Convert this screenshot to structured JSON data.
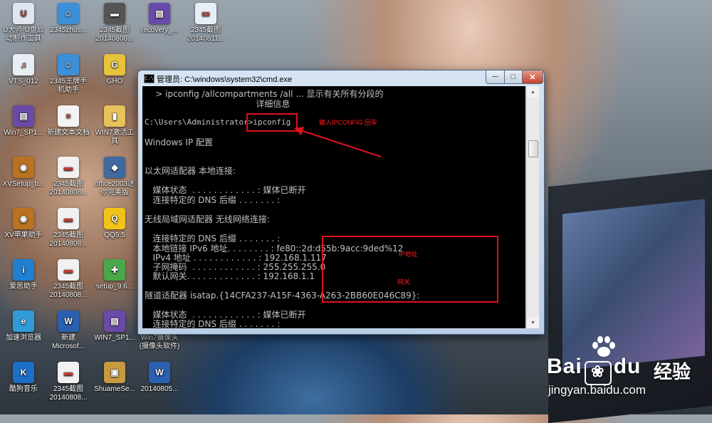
{
  "desktop": {
    "icons": [
      {
        "label": "U大师·U盘启\n动制作工具",
        "icon": "usb-tool-icon",
        "color": "#dfe6ef",
        "glyph": "U"
      },
      {
        "label": "2345zhus...",
        "icon": "helper-icon",
        "color": "#3d8fd8",
        "glyph": "☺"
      },
      {
        "label": "2345截图\n20140808...",
        "icon": "screenshot-icon",
        "color": "#555555",
        "glyph": "▬"
      },
      {
        "label": "recovery_...",
        "icon": "winrar-icon",
        "color": "#6a4aa8",
        "glyph": "▤"
      },
      {
        "label": "2345截图\n20140811...",
        "icon": "screenshot-icon",
        "color": "#e8eef5",
        "glyph": "▭"
      },
      {
        "label": "VTS_012",
        "icon": "mp3-icon",
        "color": "#e8eef5",
        "glyph": "♫"
      },
      {
        "label": "2345王牌手\n机助手",
        "icon": "phone-helper-icon",
        "color": "#3d8fd8",
        "glyph": "☺"
      },
      {
        "label": "GHO",
        "icon": "gho-icon",
        "color": "#e6c33a",
        "glyph": "G"
      },
      {
        "label": "Win7_SP1...",
        "icon": "winrar-icon",
        "color": "#6a4aa8",
        "glyph": "▤"
      },
      {
        "label": "新建文本文档",
        "icon": "text-file-icon",
        "color": "#f3f3f3",
        "glyph": "≡"
      },
      {
        "label": "WIN7激活工\n具",
        "icon": "folder-icon",
        "color": "#e8c25a",
        "glyph": "▮"
      },
      {
        "label": "XVSetup_b...",
        "icon": "owl-icon",
        "color": "#b9721f",
        "glyph": "◉"
      },
      {
        "label": "2345截图\n20140808...",
        "icon": "screenshot-icon",
        "color": "#f1f1f1",
        "glyph": "▬"
      },
      {
        "label": "office2003迷\n你完美版",
        "icon": "office-icon",
        "color": "#3f6aa0",
        "glyph": "◆"
      },
      {
        "label": "XV苹果助手",
        "icon": "owl-icon",
        "color": "#b9721f",
        "glyph": "◉"
      },
      {
        "label": "2345截图\n20140808...",
        "icon": "screenshot-icon",
        "color": "#f1f1f1",
        "glyph": "▬"
      },
      {
        "label": "QQ5.5",
        "icon": "qq-icon",
        "color": "#f0c419",
        "glyph": "Q"
      },
      {
        "label": "爱思助手",
        "icon": "aisi-icon",
        "color": "#1f7fd1",
        "glyph": "i"
      },
      {
        "label": "2345截图\n20140808...",
        "icon": "screenshot-icon",
        "color": "#f1f1f1",
        "glyph": "▬"
      },
      {
        "label": "setup_9.6...",
        "icon": "game-icon",
        "color": "#4aa84a",
        "glyph": "✚"
      },
      {
        "label": "加速浏览器",
        "icon": "browser-icon",
        "color": "#2f9bd8",
        "glyph": "e"
      },
      {
        "label": "新建\nMicrosof...",
        "icon": "word-doc-icon",
        "color": "#2b5fb0",
        "glyph": "W"
      },
      {
        "label": "WIN7_SP1...",
        "icon": "winrar-icon",
        "color": "#6a4aa8",
        "glyph": "▤"
      },
      {
        "label": "Win7摄像头\n(摄像头软件)",
        "icon": "camera-icon",
        "color": "#5a5a5a",
        "glyph": "◎"
      },
      {
        "label": "酷狗音乐",
        "icon": "kugou-icon",
        "color": "#1b6fc8",
        "glyph": "K"
      },
      {
        "label": "2345截图\n20140808...",
        "icon": "screenshot-icon",
        "color": "#f1f1f1",
        "glyph": "▬"
      },
      {
        "label": "ShuameSe...",
        "icon": "package-icon",
        "color": "#c89a3e",
        "glyph": "▣"
      },
      {
        "label": "20140805...",
        "icon": "word-doc-icon",
        "color": "#2b5fb0",
        "glyph": "W"
      }
    ]
  },
  "window": {
    "title": "管理员: C:\\windows\\system32\\cmd.exe",
    "title_icon": "C:\\",
    "controls": {
      "minimize": "─",
      "maximize": "□",
      "close": "✕"
    }
  },
  "console": {
    "lines": [
      "    > ipconfig /allcompartments /all ... 显示有关所有分段的",
      "                                         详细信息",
      "C:\\Users\\Administrator>ipconfig",
      "Windows IP 配置",
      "以太网适配器 本地连接:",
      "   媒体状态  . . . . . . . . . . . . : 媒体已断开",
      "   连接特定的 DNS 后缀 . . . . . . . :",
      "无线局域网适配器 无线网络连接:",
      "   连接特定的 DNS 后缀 . . . . . . . :",
      "   本地链接 IPv6 地址. . . . . . . . : fe80::2d:d55b:9acc:9ded%12",
      "   IPv4 地址 . . . . . . . . . . . . : 192.168.1.117",
      "   子网掩码  . . . . . . . . . . . . : 255.255.255.0",
      "   默认网关. . . . . . . . . . . . . : 192.168.1.1",
      "隧道适配器 isatap.{14CFA237-A15F-4363-A263-2BB60E046C89}:",
      "   媒体状态  . . . . . . . . . . . . : 媒体已断开",
      "   连接特定的 DNS 后缀 . . . . . . . :"
    ]
  },
  "annotations": {
    "command_note": "输入IPCONFIG  回车",
    "ip_note": "IP地址",
    "gateway_note": "网关",
    "color": "#e0101a"
  },
  "watermark": {
    "brand_left": "Bai",
    "brand_right": "du",
    "experience": "经验",
    "url": "jingyan.baidu.com"
  }
}
